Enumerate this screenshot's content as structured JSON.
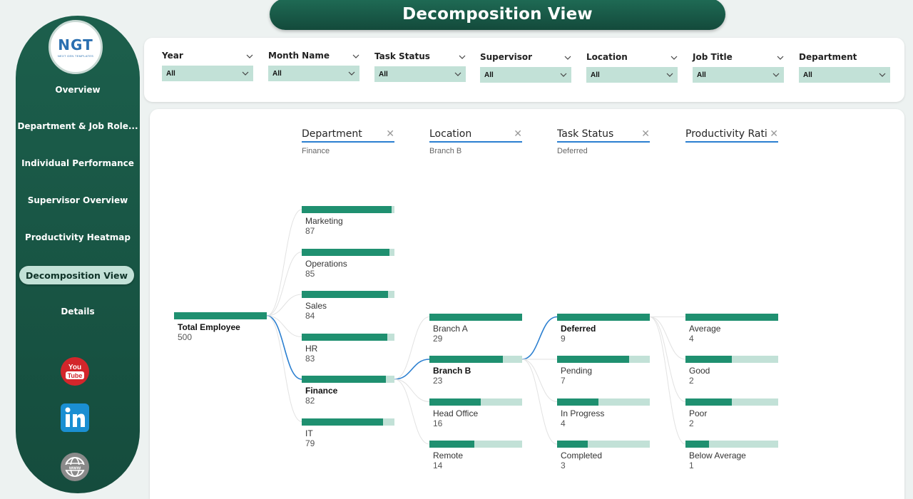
{
  "header": {
    "title": "Decomposition View"
  },
  "logo": {
    "text": "NGT",
    "subtitle": "NEXT GEN TEMPLATES"
  },
  "sidebar": {
    "items": [
      {
        "label": "Overview",
        "active": false
      },
      {
        "label": "Department & Job Role...",
        "active": false
      },
      {
        "label": "Individual Performance",
        "active": false
      },
      {
        "label": "Supervisor Overview",
        "active": false
      },
      {
        "label": "Productivity Heatmap",
        "active": false
      },
      {
        "label": "Decomposition View",
        "active": true
      },
      {
        "label": "Details",
        "active": false
      }
    ],
    "social": [
      {
        "icon": "youtube-icon",
        "text": "You Tube",
        "color": "#d3262b"
      },
      {
        "icon": "linkedin-icon",
        "text": "in",
        "color": "#1b8fd2"
      },
      {
        "icon": "website-icon",
        "text": "www",
        "color": "#8a8a8a"
      }
    ]
  },
  "filters": [
    {
      "label": "Year",
      "value": "All"
    },
    {
      "label": "Month Name",
      "value": "All"
    },
    {
      "label": "Task Status",
      "value": "All"
    },
    {
      "label": "Supervisor",
      "value": "All"
    },
    {
      "label": "Location",
      "value": "All"
    },
    {
      "label": "Job Title",
      "value": "All"
    },
    {
      "label": "Department",
      "value": "All"
    }
  ],
  "colors": {
    "accent": "#1f9070",
    "bar_background": "#c2e1d7",
    "sidebar": "#1c5f4c",
    "link_highlight": "#2b7fd0"
  },
  "decomposition": {
    "root": {
      "label": "Total Employee",
      "value": 500
    },
    "levels": [
      {
        "title": "Department",
        "selected": "Finance",
        "nodes": [
          {
            "label": "Marketing",
            "value": 87
          },
          {
            "label": "Operations",
            "value": 85
          },
          {
            "label": "Sales",
            "value": 84
          },
          {
            "label": "HR",
            "value": 83
          },
          {
            "label": "Finance",
            "value": 82
          },
          {
            "label": "IT",
            "value": 79
          }
        ]
      },
      {
        "title": "Location",
        "selected": "Branch B",
        "nodes": [
          {
            "label": "Branch A",
            "value": 29
          },
          {
            "label": "Branch B",
            "value": 23
          },
          {
            "label": "Head Office",
            "value": 16
          },
          {
            "label": "Remote",
            "value": 14
          }
        ]
      },
      {
        "title": "Task Status",
        "selected": "Deferred",
        "nodes": [
          {
            "label": "Deferred",
            "value": 9
          },
          {
            "label": "Pending",
            "value": 7
          },
          {
            "label": "In Progress",
            "value": 4
          },
          {
            "label": "Completed",
            "value": 3
          }
        ]
      },
      {
        "title": "Productivity Rati...",
        "selected": "",
        "nodes": [
          {
            "label": "Average",
            "value": 4
          },
          {
            "label": "Good",
            "value": 2
          },
          {
            "label": "Poor",
            "value": 2
          },
          {
            "label": "Below Average",
            "value": 1
          }
        ]
      }
    ]
  }
}
